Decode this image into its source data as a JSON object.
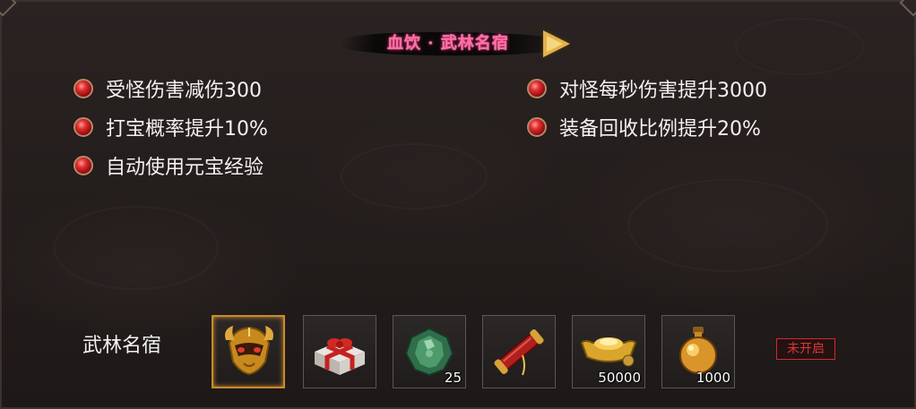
{
  "panel": {
    "title": "血饮 · 武林名宿",
    "bonuses_left": [
      "受怪伤害减伤300",
      "打宝概率提升10%",
      "自动使用元宝经验"
    ],
    "bonuses_right": [
      "对怪每秒伤害提升3000",
      "装备回收比例提升20%"
    ]
  },
  "rewards": {
    "label": "武林名宿",
    "items": [
      {
        "icon": "golden-mask-icon",
        "qty": ""
      },
      {
        "icon": "gift-box-icon",
        "qty": ""
      },
      {
        "icon": "green-gem-icon",
        "qty": "25"
      },
      {
        "icon": "red-scroll-icon",
        "qty": ""
      },
      {
        "icon": "gold-ingot-icon",
        "qty": "50000"
      },
      {
        "icon": "gold-potion-icon",
        "qty": "1000"
      }
    ],
    "status": "未开启"
  },
  "colors": {
    "title": "#ff6fa6",
    "status": "#e23434",
    "selected_border": "#c98a2e"
  }
}
